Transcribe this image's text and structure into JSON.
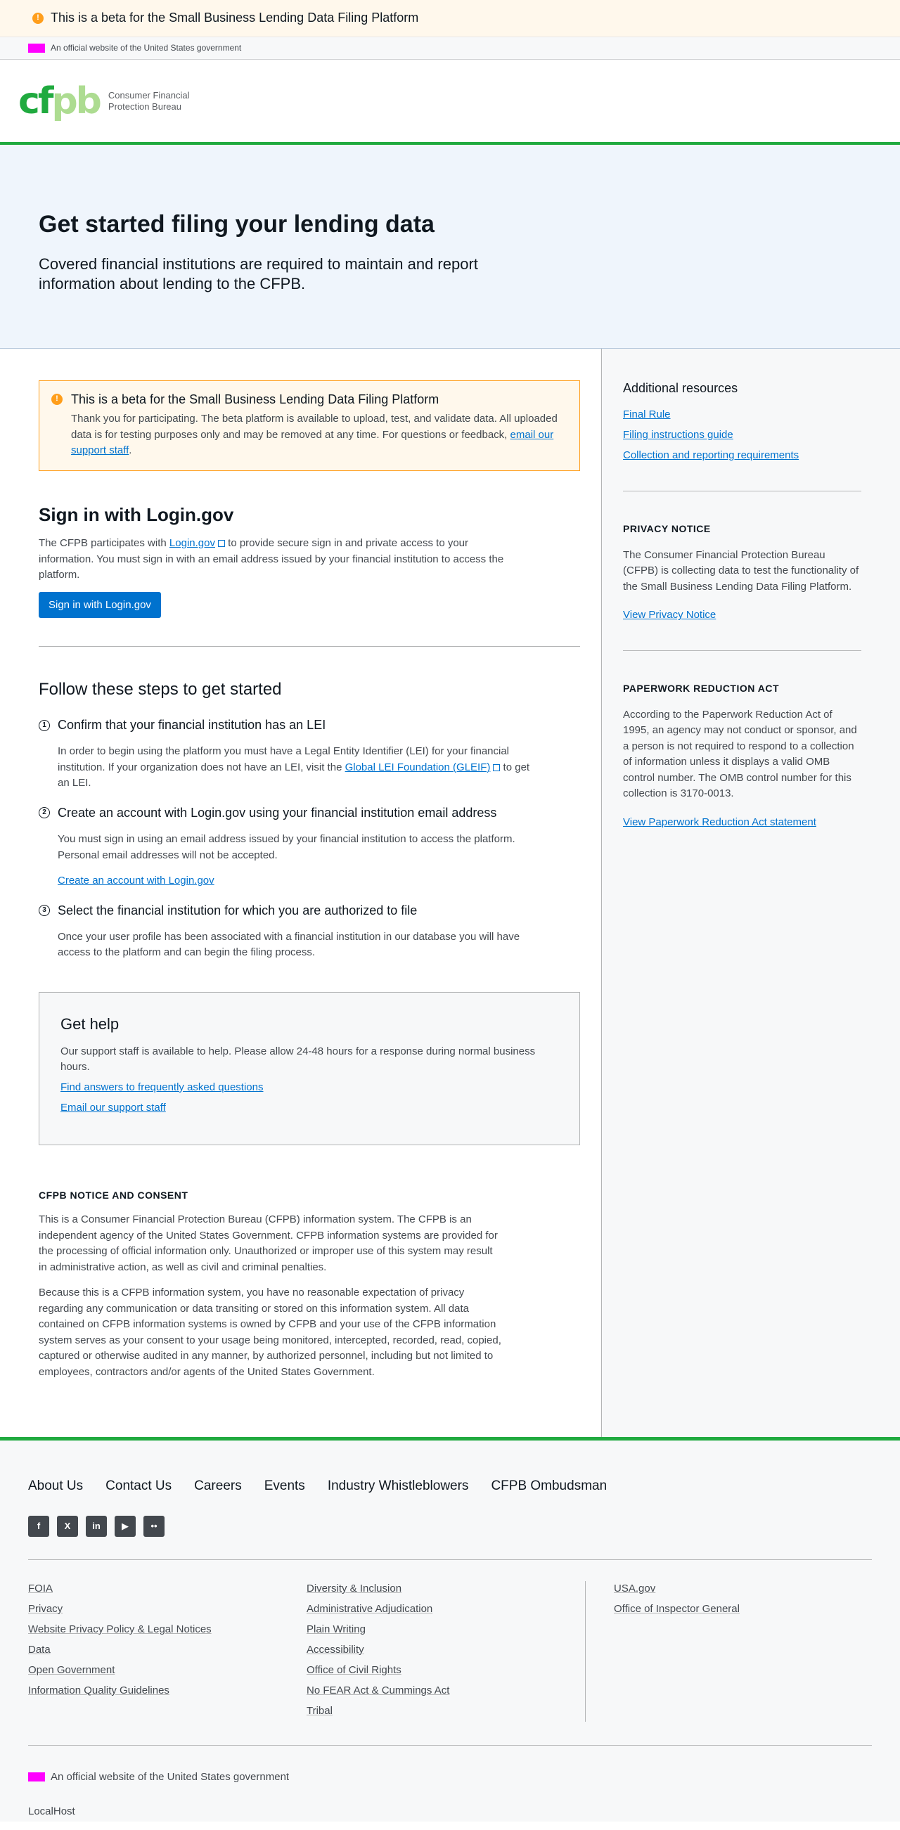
{
  "top_banner": {
    "text": "This is a beta for the Small Business Lending Data Filing Platform"
  },
  "gov_banner": {
    "text": "An official website of the United States government"
  },
  "header": {
    "logo_mark_c": "cf",
    "logo_mark_p": "pb",
    "logo_text_1": "Consumer Financial",
    "logo_text_2": "Protection Bureau"
  },
  "hero": {
    "title": "Get started filing your lending data",
    "lead": "Covered financial institutions are required to maintain and report information about lending to the CFPB."
  },
  "alert": {
    "title": "This is a beta for the Small Business Lending Data Filing Platform",
    "text": "Thank you for participating. The beta platform is available to upload, test, and validate data. All uploaded data is for testing purposes only and may be removed at any time. For questions or feedback,",
    "link": "email our support staff",
    "end": "."
  },
  "signin": {
    "title": "Sign in with Login.gov",
    "text_1": "The CFPB participates with",
    "link": "Login.gov",
    "text_2": "to provide secure sign in and private access to your information. You must sign in with an email address issued by your financial institution to access the platform.",
    "button": "Sign in with Login.gov"
  },
  "steps": {
    "title": "Follow these steps to get started",
    "items": [
      {
        "num": "1",
        "title": "Confirm that your financial institution has an LEI",
        "text_1": "In order to begin using the platform you must have a Legal Entity Identifier (LEI) for your financial institution. If your organization does not have an LEI, visit the",
        "link": "Global LEI Foundation (GLEIF)",
        "text_2": "to get an LEI."
      },
      {
        "num": "2",
        "title": "Create an account with Login.gov using your financial institution email address",
        "text": "You must sign in using an email address issued by your financial institution to access the platform. Personal email addresses will not be accepted.",
        "link": "Create an account with Login.gov"
      },
      {
        "num": "3",
        "title": "Select the financial institution for which you are authorized to file",
        "text": "Once your user profile has been associated with a financial institution in our database you will have access to the platform and can begin the filing process."
      }
    ]
  },
  "help": {
    "title": "Get help",
    "text": "Our support staff is available to help. Please allow 24-48 hours for a response during normal business hours.",
    "link_1": "Find answers to frequently asked questions",
    "link_2": "Email our support staff"
  },
  "notice": {
    "title": "CFPB NOTICE AND CONSENT",
    "p1": "This is a Consumer Financial Protection Bureau (CFPB) information system. The CFPB is an independent agency of the United States Government. CFPB information systems are provided for the processing of official information only. Unauthorized or improper use of this system may result in administrative action, as well as civil and criminal penalties.",
    "p2": "Because this is a CFPB information system, you have no reasonable expectation of privacy regarding any communication or data transiting or stored on this information system. All data contained on CFPB information systems is owned by CFPB and your use of the CFPB information system serves as your consent to your usage being monitored, intercepted, recorded, read, copied, captured or otherwise audited in any manner, by authorized personnel, including but not limited to employees, contractors and/or agents of the United States Government."
  },
  "sidebar": {
    "resources_title": "Additional resources",
    "resources": [
      "Final Rule",
      "Filing instructions guide",
      "Collection and reporting requirements"
    ],
    "privacy_title": "PRIVACY NOTICE",
    "privacy_text": "The Consumer Financial Protection Bureau (CFPB) is collecting data to test the functionality of the Small Business Lending Data Filing Platform.",
    "privacy_link": "View Privacy Notice",
    "pra_title": "PAPERWORK REDUCTION ACT",
    "pra_text": "According to the Paperwork Reduction Act of 1995, an agency may not conduct or sponsor, and a person is not required to respond to a collection of information unless it displays a valid OMB control number. The OMB control number for this collection is 3170-0013.",
    "pra_link": "View Paperwork Reduction Act statement"
  },
  "footer": {
    "nav": [
      "About Us",
      "Contact Us",
      "Careers",
      "Events",
      "Industry Whistleblowers",
      "CFPB Ombudsman"
    ],
    "social": [
      "f",
      "X",
      "in",
      "▶",
      "••"
    ],
    "col1": [
      "FOIA",
      "Privacy",
      "Website Privacy Policy & Legal Notices",
      "Data",
      "Open Government",
      "Information Quality Guidelines"
    ],
    "col2": [
      "Diversity & Inclusion",
      "Administrative Adjudication",
      "Plain Writing",
      "Accessibility",
      "Office of Civil Rights",
      "No FEAR Act & Cummings Act",
      "Tribal"
    ],
    "col3": [
      "USA.gov",
      "Office of Inspector General"
    ],
    "official": "An official website of the United States government",
    "host": "LocalHost"
  }
}
